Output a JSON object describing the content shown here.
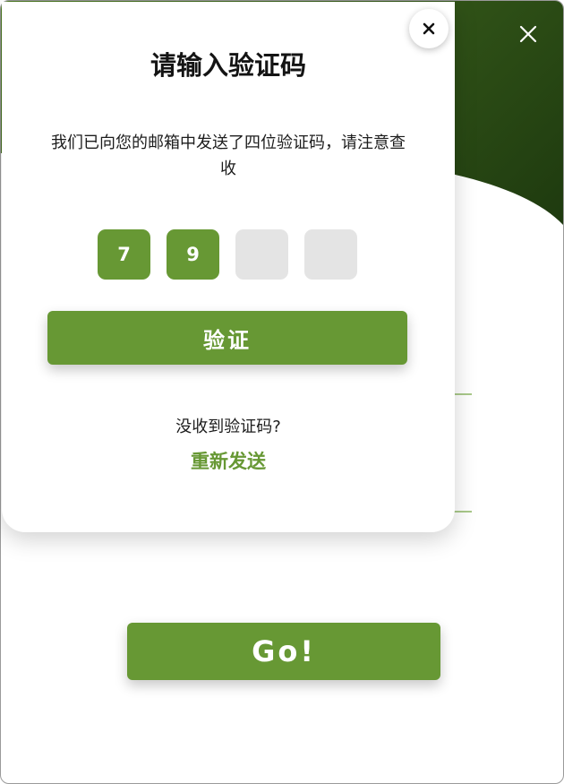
{
  "background": {
    "close_icon": "close-icon",
    "go_button_label": "Go!"
  },
  "modal": {
    "close_icon": "close-icon",
    "title": "请输入验证码",
    "description": "我们已向您的邮箱中发送了四位验证码，请注意查收",
    "code_digits": [
      "7",
      "9",
      "",
      ""
    ],
    "verify_button_label": "验证",
    "no_code_text": "没收到验证码?",
    "resend_label": "重新发送"
  },
  "colors": {
    "accent": "#679834",
    "hero_dark": "#1e3a0f",
    "empty_box": "#e4e4e4"
  }
}
